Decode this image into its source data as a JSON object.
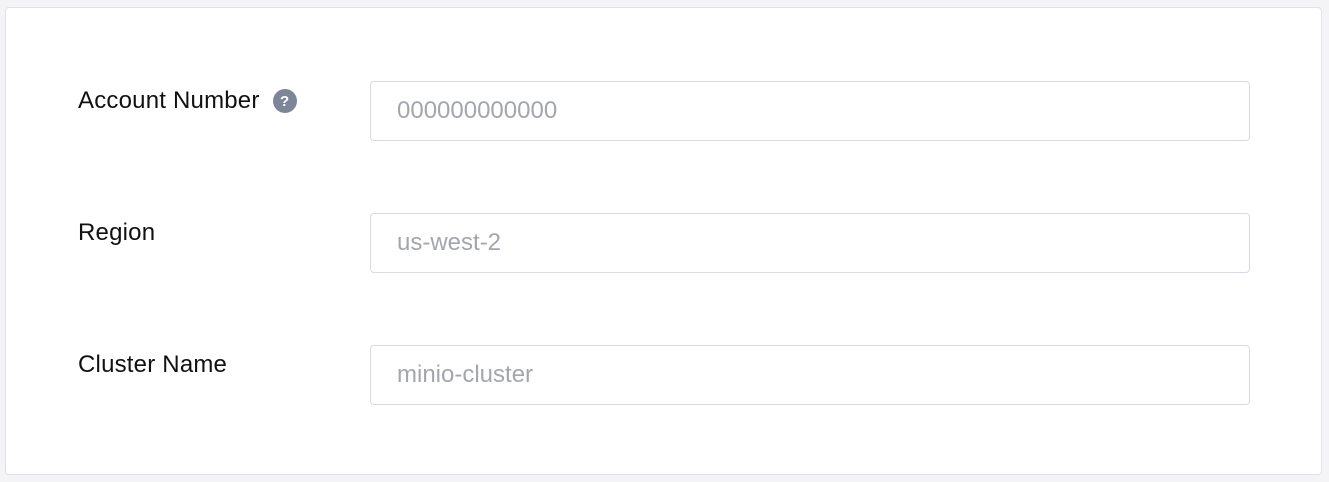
{
  "form": {
    "fields": [
      {
        "label": "Account Number",
        "placeholder": "000000000000",
        "value": "",
        "has_help": true,
        "help_icon": "question-circle-icon",
        "help_glyph": "?"
      },
      {
        "label": "Region",
        "placeholder": "us-west-2",
        "value": ""
      },
      {
        "label": "Cluster Name",
        "placeholder": "minio-cluster",
        "value": ""
      }
    ]
  },
  "colors": {
    "help_icon_bg": "#7d8699",
    "placeholder": "#a4a6ae",
    "input_border": "#d9dbe0"
  }
}
